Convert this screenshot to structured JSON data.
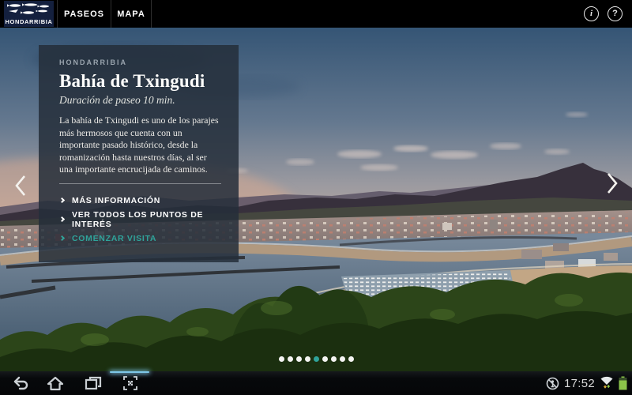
{
  "app_bar": {
    "logo_text": "HONDARRIBIA",
    "tabs": [
      {
        "label": "PASEOS"
      },
      {
        "label": "MAPA"
      }
    ],
    "info_glyph": "i",
    "help_glyph": "?"
  },
  "card": {
    "eyebrow": "HONDARRIBIA",
    "title": "Bahía de Txingudi",
    "subtitle": "Duración de paseo 10 min.",
    "description": "La bahía de Txingudi es uno de los parajes más hermosos que cuenta con un importante pasado histórico, desde la romanización hasta nuestros días, al ser una importante encrucijada de caminos.",
    "links": [
      {
        "label": "MÁS INFORMACIÓN",
        "accent": false
      },
      {
        "label": "VER TODOS LOS PUNTOS DE INTERÉS",
        "accent": false
      },
      {
        "label": "COMENZAR VISITA",
        "accent": true
      }
    ]
  },
  "carousel": {
    "dots": {
      "count": 9,
      "active_index": 4
    }
  },
  "status_bar": {
    "time": "17:52"
  },
  "icons": {
    "app_bar": [
      "info-icon",
      "help-icon"
    ],
    "nav_bar": [
      "back-icon",
      "home-icon",
      "recents-icon",
      "screen-capture-icon"
    ],
    "status": [
      "do-not-disturb-icon",
      "wifi-icon",
      "battery-icon"
    ]
  },
  "colors": {
    "accent_teal": "#2fa39a",
    "active_dot": "#2fa39a",
    "battery_green": "#8bc34a",
    "nav_indicator_blue": "#7ec7e8"
  }
}
